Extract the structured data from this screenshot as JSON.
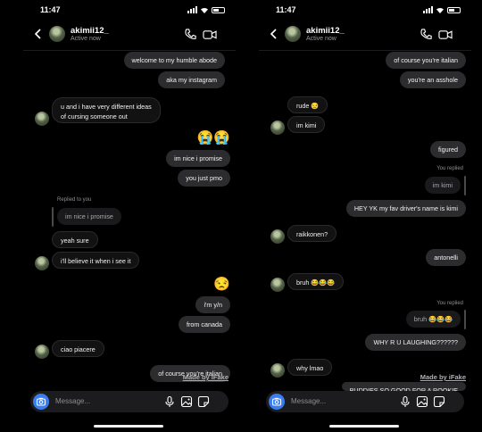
{
  "status": {
    "time": "11:47"
  },
  "chat": {
    "username": "akimii12_",
    "presence": "Active now"
  },
  "composer": {
    "placeholder": "Message..."
  },
  "watermark": "Made by iFake",
  "left": {
    "messages": [
      {
        "side": "out",
        "text": "welcome to my humble abode"
      },
      {
        "side": "out",
        "text": "aka my instagram"
      },
      {
        "side": "in",
        "text": "u and i have very different ideas of cursing someone out"
      },
      {
        "side": "out",
        "emoji": "😭😭"
      },
      {
        "side": "out",
        "text": "im nice i promise"
      },
      {
        "side": "out",
        "text": "you just pmo"
      },
      {
        "side": "in",
        "replied_label": "Replied to you",
        "quote": "im nice i promise"
      },
      {
        "side": "in",
        "text": "yeah sure"
      },
      {
        "side": "in",
        "text": "i'll believe it when i see it"
      },
      {
        "side": "out",
        "emoji": "😒"
      },
      {
        "side": "out",
        "text": "i'm y/n"
      },
      {
        "side": "out",
        "text": "from canada"
      },
      {
        "side": "in",
        "text": "ciao piacere"
      },
      {
        "side": "out",
        "text": "of course you're italian"
      }
    ]
  },
  "right": {
    "messages": [
      {
        "side": "out",
        "text": "of course you're italian"
      },
      {
        "side": "out",
        "text": "you're an asshole"
      },
      {
        "side": "in",
        "text": "rude 😒"
      },
      {
        "side": "in",
        "text": "im kimi"
      },
      {
        "side": "out",
        "text": "figured"
      },
      {
        "side": "out",
        "replied_label": "You replied",
        "quote": "im kimi"
      },
      {
        "side": "out",
        "text": "HEY YK my fav driver's name is kimi"
      },
      {
        "side": "in",
        "text": "raikkonen?"
      },
      {
        "side": "out",
        "text": "antonelli"
      },
      {
        "side": "in",
        "text": "bruh 😂😂😂"
      },
      {
        "side": "out",
        "replied_label": "You replied",
        "quote": "bruh 😂😂😂"
      },
      {
        "side": "out",
        "text": "WHY R U LAUGHING??????"
      },
      {
        "side": "in",
        "text": "why lmao"
      },
      {
        "side": "out",
        "text": "BUDDIES SO GOOD FOR A ROOKIE"
      }
    ]
  }
}
